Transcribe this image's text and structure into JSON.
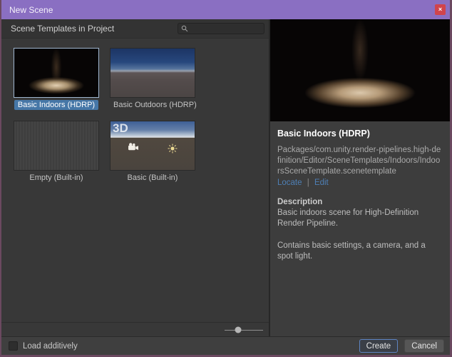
{
  "window": {
    "title": "New Scene",
    "close_glyph": "×"
  },
  "left_panel": {
    "header": "Scene Templates in Project",
    "search": {
      "value": "",
      "placeholder": ""
    },
    "templates": [
      {
        "label": "Basic Indoors (HDRP)",
        "selected": true,
        "thumb": "indoors-spotlight"
      },
      {
        "label": "Basic Outdoors (HDRP)",
        "selected": false,
        "thumb": "outdoors-sky"
      },
      {
        "label": "Empty (Built-in)",
        "selected": false,
        "thumb": "empty-gray"
      },
      {
        "label": "Basic (Built-in)",
        "selected": false,
        "thumb": "basic-3d-scene",
        "badge": "3D"
      }
    ],
    "slider": {
      "percent": 35
    }
  },
  "right_panel": {
    "title": "Basic Indoors (HDRP)",
    "path": "Packages/com.unity.render-pipelines.high-definition/Editor/SceneTemplates/Indoors/IndoorsSceneTemplate.scenetemplate",
    "locate_label": "Locate",
    "link_separator": "|",
    "edit_label": "Edit",
    "description_heading": "Description",
    "description_para1": "Basic indoors scene for High-Definition Render Pipeline.",
    "description_para2": "Contains basic settings, a camera, and a spot light."
  },
  "footer": {
    "load_additively_label": "Load additively",
    "load_additively_checked": false,
    "create_label": "Create",
    "cancel_label": "Cancel"
  },
  "icons": {
    "close": "x-glyph",
    "search": "magnifier",
    "camera": "video-camera",
    "sun": "directional-light"
  },
  "colors": {
    "titlebar": "#8a6fc2",
    "close_button": "#d0444c",
    "selection_blue": "#4677a7",
    "link_blue": "#4e7fb5",
    "create_border": "#5d84c2",
    "window_border": "#6b4960",
    "panel_bg": "#383838",
    "details_bg": "#3d3d3d"
  }
}
